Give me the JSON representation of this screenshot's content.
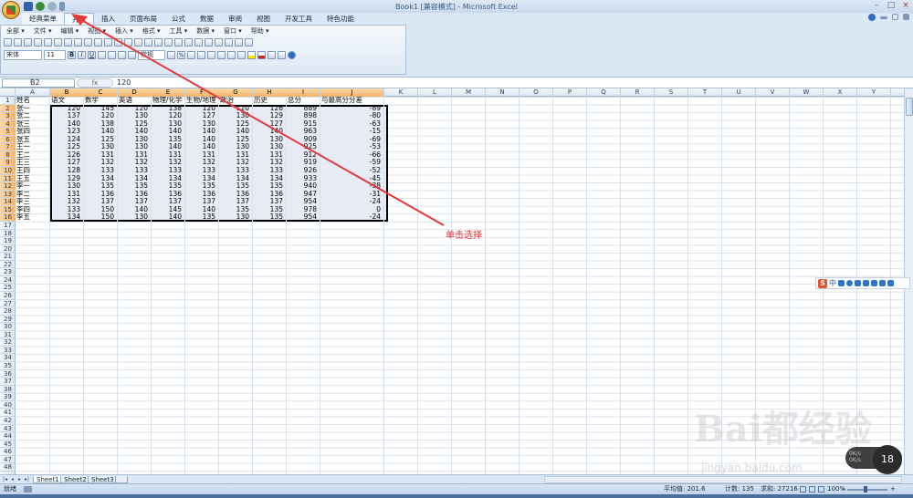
{
  "window": {
    "title": "Book1  [兼容模式] - Microsoft Excel",
    "controls": [
      "–",
      "□",
      "×"
    ]
  },
  "ribbon_tabs": [
    "经典菜单",
    "开始",
    "插入",
    "页面布局",
    "公式",
    "数据",
    "审阅",
    "视图",
    "开发工具",
    "特色功能"
  ],
  "active_tab": 1,
  "classic_menu": [
    "全部 ▾",
    "文件 ▾",
    "编辑 ▾",
    "视图 ▾",
    "插入 ▾",
    "格式 ▾",
    "工具 ▾",
    "数据 ▾",
    "窗口 ▾",
    "帮助 ▾"
  ],
  "toolbar": {
    "font_name": "宋体",
    "font_size": "11",
    "bold": "B",
    "italic": "I",
    "underline": "U",
    "number_format": "常规",
    "percent": "%"
  },
  "formula_bar": {
    "name_box": "B2",
    "fx_label": "fx",
    "value": "120"
  },
  "columns": [
    "A",
    "B",
    "C",
    "D",
    "E",
    "F",
    "G",
    "H",
    "I",
    "J",
    "K",
    "L",
    "M",
    "N",
    "O",
    "P",
    "Q",
    "R",
    "S",
    "T",
    "U",
    "V",
    "W",
    "X",
    "Y"
  ],
  "selected_columns": [
    "B",
    "C",
    "D",
    "E",
    "F",
    "G",
    "H",
    "I",
    "J"
  ],
  "rows_visible": 48,
  "selected_rows": [
    2,
    16
  ],
  "table": {
    "headers": [
      "姓名",
      "语文",
      "数学",
      "英语",
      "物理/化学",
      "生物/地理",
      "政治",
      "历史",
      "总分",
      "与最高分分差"
    ],
    "rows": [
      [
        "张一",
        "120",
        "145",
        "120",
        "138",
        "120",
        "120",
        "126",
        "889",
        "-89"
      ],
      [
        "张二",
        "137",
        "120",
        "130",
        "120",
        "127",
        "130",
        "129",
        "898",
        "-80"
      ],
      [
        "张三",
        "140",
        "138",
        "125",
        "130",
        "130",
        "125",
        "127",
        "915",
        "-63"
      ],
      [
        "张四",
        "123",
        "140",
        "140",
        "140",
        "140",
        "140",
        "140",
        "963",
        "-15"
      ],
      [
        "张五",
        "124",
        "125",
        "130",
        "135",
        "140",
        "125",
        "130",
        "909",
        "-69"
      ],
      [
        "王一",
        "125",
        "130",
        "130",
        "140",
        "140",
        "130",
        "130",
        "925",
        "-53"
      ],
      [
        "王二",
        "126",
        "131",
        "131",
        "131",
        "131",
        "131",
        "131",
        "912",
        "-66"
      ],
      [
        "王三",
        "127",
        "132",
        "132",
        "132",
        "132",
        "132",
        "132",
        "919",
        "-59"
      ],
      [
        "王四",
        "128",
        "133",
        "133",
        "133",
        "133",
        "133",
        "133",
        "926",
        "-52"
      ],
      [
        "王五",
        "129",
        "134",
        "134",
        "134",
        "134",
        "134",
        "134",
        "933",
        "-45"
      ],
      [
        "李一",
        "130",
        "135",
        "135",
        "135",
        "135",
        "135",
        "135",
        "940",
        "-38"
      ],
      [
        "李二",
        "131",
        "136",
        "136",
        "136",
        "136",
        "136",
        "136",
        "947",
        "-31"
      ],
      [
        "李三",
        "132",
        "137",
        "137",
        "137",
        "137",
        "137",
        "137",
        "954",
        "-24"
      ],
      [
        "李四",
        "133",
        "150",
        "140",
        "145",
        "140",
        "135",
        "135",
        "978",
        "0"
      ],
      [
        "李五",
        "134",
        "150",
        "130",
        "140",
        "135",
        "130",
        "135",
        "954",
        "-24"
      ]
    ]
  },
  "annotation": "单击选择",
  "sheets": [
    "Sheet1",
    "Sheet2",
    "Sheet3"
  ],
  "sheet_nav": [
    "|◂",
    "◂",
    "▸",
    "▸|"
  ],
  "status": {
    "ready": "就绪",
    "average": "平均值: 201.6",
    "count": "计数: 135",
    "sum": "求和: 27216",
    "zoom": "100%",
    "zoom_minus": "–",
    "zoom_plus": "+"
  },
  "ime": {
    "brand": "S",
    "lang": "中"
  },
  "widget": {
    "speed": "0K/s",
    "speed2": "0K/s",
    "count": "18"
  },
  "watermark": {
    "logo": "Bai都经验",
    "url": "jingyan.baidu.com"
  },
  "colors": {
    "accent": "#e03030",
    "selection_header": "#f5b26a",
    "ribbon": "#dbe7f5"
  }
}
